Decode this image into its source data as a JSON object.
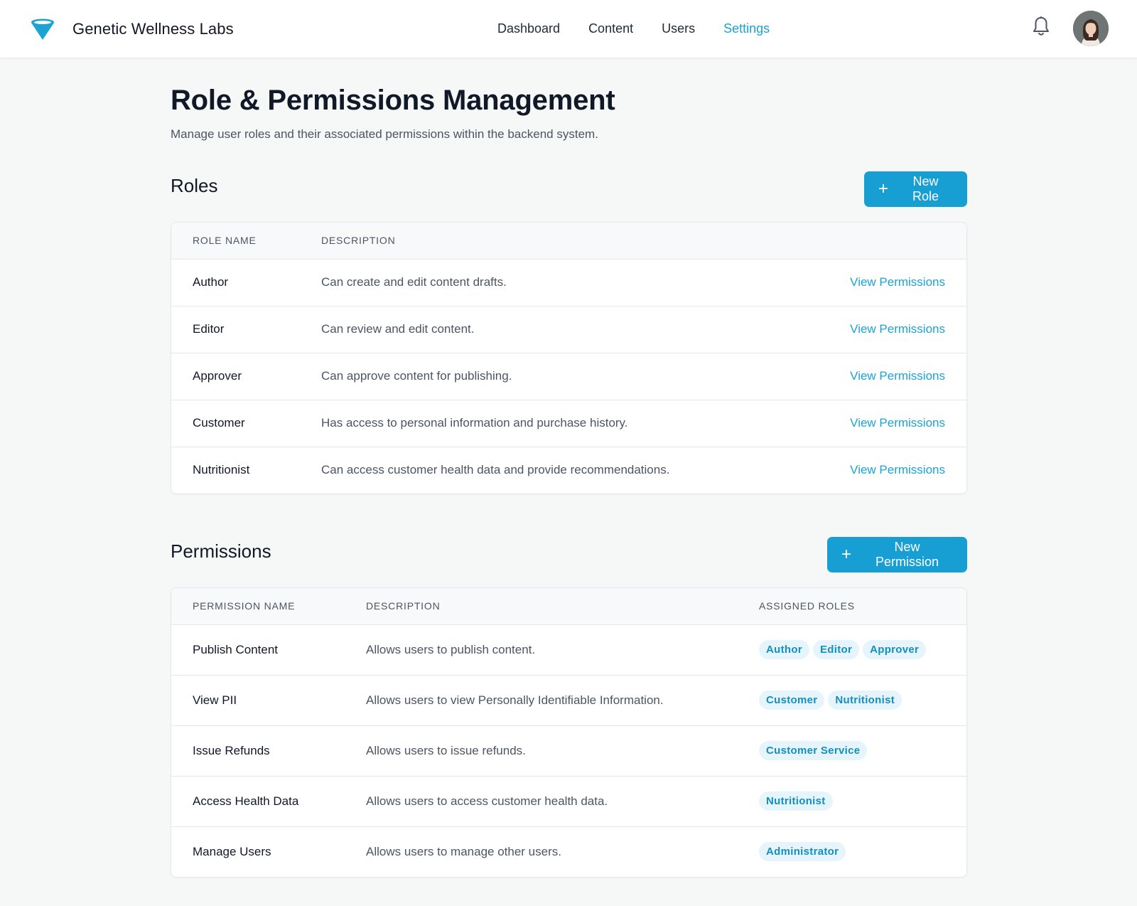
{
  "header": {
    "brand_name": "Genetic Wellness Labs",
    "nav": [
      {
        "label": "Dashboard",
        "active": false
      },
      {
        "label": "Content",
        "active": false
      },
      {
        "label": "Users",
        "active": false
      },
      {
        "label": "Settings",
        "active": true
      }
    ],
    "icons": {
      "logo": "funnel-logo-icon",
      "notifications": "bell-icon",
      "avatar": "user-avatar"
    },
    "accent_color": "#1ba3d4"
  },
  "page": {
    "title": "Role & Permissions Management",
    "subtitle": "Manage user roles and their associated permissions within the backend system."
  },
  "roles": {
    "title": "Roles",
    "new_button": "New Role",
    "columns": [
      "ROLE NAME",
      "DESCRIPTION"
    ],
    "rows": [
      {
        "name": "Author",
        "description": "Can create and edit content drafts.",
        "action": "View Permissions"
      },
      {
        "name": "Editor",
        "description": "Can review and edit content.",
        "action": "View Permissions"
      },
      {
        "name": "Approver",
        "description": "Can approve content for publishing.",
        "action": "View Permissions"
      },
      {
        "name": "Customer",
        "description": "Has access to personal information and purchase history.",
        "action": "View Permissions"
      },
      {
        "name": "Nutritionist",
        "description": "Can access customer health data and provide recommendations.",
        "action": "View Permissions"
      }
    ]
  },
  "permissions": {
    "title": "Permissions",
    "new_button": "New Permission",
    "columns": [
      "PERMISSION NAME",
      "DESCRIPTION",
      "ASSIGNED ROLES"
    ],
    "rows": [
      {
        "name": "Publish Content",
        "description": "Allows users to publish content.",
        "roles": [
          "Author",
          "Editor",
          "Approver"
        ]
      },
      {
        "name": "View PII",
        "description": "Allows users to view Personally Identifiable Information.",
        "roles": [
          "Customer",
          "Nutritionist"
        ]
      },
      {
        "name": "Issue Refunds",
        "description": "Allows users to issue refunds.",
        "roles": [
          "Customer Service"
        ]
      },
      {
        "name": "Access Health Data",
        "description": "Allows users to access customer health data.",
        "roles": [
          "Nutritionist"
        ]
      },
      {
        "name": "Manage Users",
        "description": "Allows users to manage other users.",
        "roles": [
          "Administrator"
        ]
      }
    ]
  }
}
